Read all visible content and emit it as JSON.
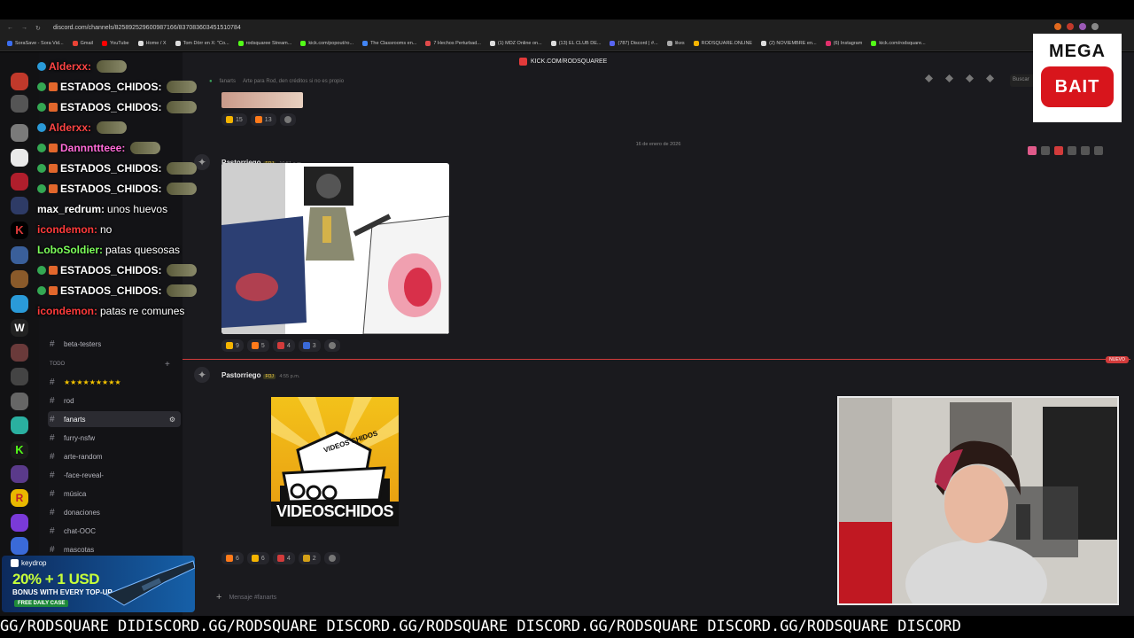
{
  "browser": {
    "url": "discord.com/channels/825892529600987166/837083603451510784",
    "bookmarks": [
      "SoraSave - Sora Vid...",
      "Gmail",
      "YouTube",
      "Home / X",
      "Tom Dörr en X: \"Co...",
      "rodsquaree Stream...",
      "kick.com/popout/ro...",
      "The Classrooms en...",
      "7 Hechos Perturbad...",
      "(1) MDZ Online on...",
      "(13) EL CLUB DE...",
      "(787) Discord | #...",
      "likes",
      "RODSQUARE.ONLINE",
      "(2) NOVIEMBRE en...",
      "(6) Instagram",
      "kick.com/rodsquare..."
    ],
    "kick_banner": "KICK.COM/RODSQUAREE"
  },
  "mega_bait": {
    "line1": "MEGA",
    "line2": "BAIT"
  },
  "chat_overlay": [
    {
      "user": "Alderxx:",
      "color": "#ff4545",
      "text": "",
      "badge": "blue",
      "emote": true
    },
    {
      "user": "ESTADOS_CHIDOS:",
      "color": "#ffffff",
      "text": "",
      "badge": "green",
      "emote": true
    },
    {
      "user": "ESTADOS_CHIDOS:",
      "color": "#ffffff",
      "text": "",
      "badge": "green",
      "emote": true
    },
    {
      "user": "Alderxx:",
      "color": "#ff4545",
      "text": "",
      "badge": "blue",
      "emote": true
    },
    {
      "user": "Dannnttteee:",
      "color": "#ff6bd8",
      "text": "",
      "badge": "green",
      "emote": true
    },
    {
      "user": "ESTADOS_CHIDOS:",
      "color": "#ffffff",
      "text": "",
      "badge": "green",
      "emote": true
    },
    {
      "user": "ESTADOS_CHIDOS:",
      "color": "#ffffff",
      "text": "",
      "badge": "green",
      "emote": true
    },
    {
      "user": "max_redrum:",
      "color": "#ffffff",
      "text": "unos huevos",
      "badge": "",
      "emote": false
    },
    {
      "user": "icondemon:",
      "color": "#ff3b3b",
      "text": "no",
      "badge": "",
      "emote": false
    },
    {
      "user": "LoboSoldier:",
      "color": "#7cff5a",
      "text": "patas quesosas",
      "badge": "",
      "emote": false
    },
    {
      "user": "ESTADOS_CHIDOS:",
      "color": "#ffffff",
      "text": "",
      "badge": "green",
      "emote": true
    },
    {
      "user": "ESTADOS_CHIDOS:",
      "color": "#ffffff",
      "text": "",
      "badge": "green",
      "emote": true
    },
    {
      "user": "icondemon:",
      "color": "#ff3b3b",
      "text": "patas re comunes",
      "badge": "",
      "emote": false
    }
  ],
  "channels": {
    "pre": [
      {
        "name": "beta-testers"
      }
    ],
    "category": "TODO",
    "items": [
      {
        "name": "★★★★★★★★★",
        "active": false
      },
      {
        "name": "rod",
        "active": false
      },
      {
        "name": "fanarts",
        "active": true
      },
      {
        "name": "furry-nsfw",
        "active": false
      },
      {
        "name": "arte-random",
        "active": false
      },
      {
        "name": "-face-reveal-",
        "active": false
      },
      {
        "name": "música",
        "active": false
      },
      {
        "name": "donaciones",
        "active": false
      },
      {
        "name": "chat-OOC",
        "active": false
      },
      {
        "name": "mascotas",
        "active": false
      }
    ]
  },
  "header": {
    "channel": "fanarts",
    "topic": "Arte para Rod, den créditos si no es propio",
    "search": "Buscar"
  },
  "date_divider": "16 de enero de 2026",
  "messages": [
    {
      "author": "Pastorriego",
      "badge": "FOJ",
      "time": "10:51 a.m.",
      "reactions": [
        {
          "icon": "star",
          "count": "9"
        },
        {
          "icon": "fire",
          "count": "5"
        },
        {
          "icon": "flag",
          "count": "4"
        },
        {
          "icon": "plus",
          "count": "3"
        }
      ]
    },
    {
      "author": "Pastorriego",
      "badge": "FOJ",
      "time": "4:55 p.m.",
      "reactions": [
        {
          "icon": "fire",
          "count": "6"
        },
        {
          "icon": "star",
          "count": "6"
        },
        {
          "icon": "flag",
          "count": "4"
        },
        {
          "icon": "medal",
          "count": "2"
        }
      ]
    }
  ],
  "prev_reactions": [
    "15",
    "13"
  ],
  "new_label": "NUEVO",
  "logo_text": {
    "top": "VIDEOS CHIDOS",
    "bottom": "VIDEOSCHIDOS"
  },
  "input_placeholder": "Mensaje #fanarts",
  "keydrop": {
    "brand": "keydrop",
    "headline": "20% + 1 USD",
    "sub": "BONUS WITH EVERY TOP-UP",
    "cta": "FREE DAILY CASE"
  },
  "ticker": "GG/RODSQUARE DIDISCORD.GG/RODSQUARE DISCORD.GG/RODSQUARE DISCORD.GG/RODSQUARE DISCORD.GG/RODSQUARE DISCORD",
  "colors": {
    "accent_red": "#d23b3b",
    "discord_bg": "#1a1a1e",
    "sidebar_bg": "#131316"
  }
}
